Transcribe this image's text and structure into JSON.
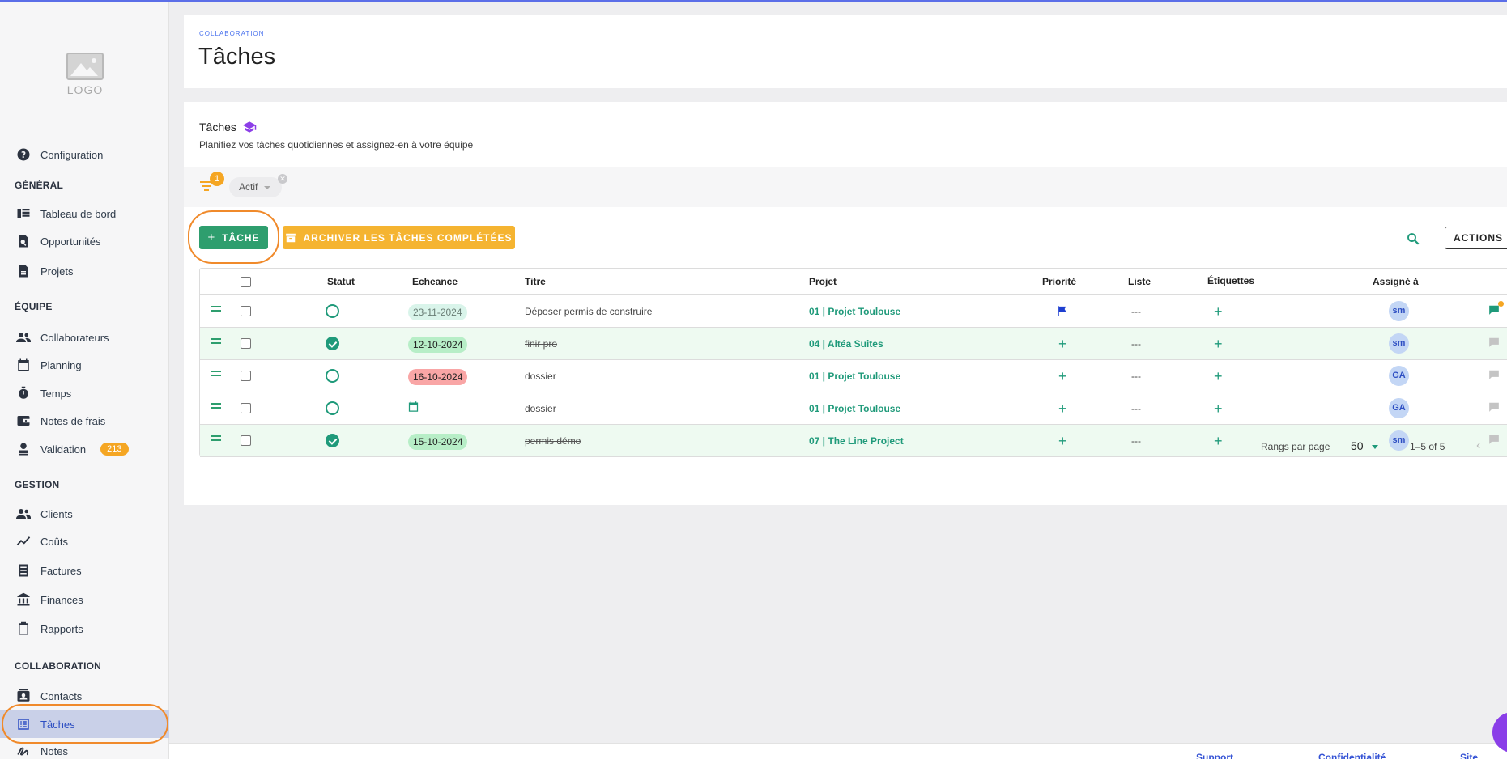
{
  "logo_text": "LOGO",
  "sidebar": {
    "config_label": "Configuration",
    "sections": {
      "general": "GÉNÉRAL",
      "equipe": "ÉQUIPE",
      "gestion": "GESTION",
      "collab": "COLLABORATION"
    },
    "items": {
      "tableau": "Tableau de bord",
      "opportunites": "Opportunités",
      "projets": "Projets",
      "collaborateurs": "Collaborateurs",
      "planning": "Planning",
      "temps": "Temps",
      "notes_frais": "Notes de frais",
      "validation": "Validation",
      "validation_count": "213",
      "clients": "Clients",
      "couts": "Coûts",
      "factures": "Factures",
      "finances": "Finances",
      "rapports": "Rapports",
      "contacts": "Contacts",
      "taches": "Tâches",
      "notes": "Notes"
    }
  },
  "header": {
    "breadcrumb": "COLLABORATION",
    "title": "Tâches"
  },
  "section": {
    "title": "Tâches",
    "subtitle": "Planifiez vos tâches quotidiennes et assignez-en à votre équipe"
  },
  "filters": {
    "count": "1",
    "chip": "Actif"
  },
  "toolbar": {
    "add_task": "TÂCHE",
    "archive": "ARCHIVER LES TÂCHES COMPLÉTÉES",
    "actions": "ACTIONS"
  },
  "table": {
    "headers": {
      "statut": "Statut",
      "echeance": "Echeance",
      "titre": "Titre",
      "projet": "Projet",
      "priorite": "Priorité",
      "liste": "Liste",
      "etiquettes": "Étiquettes",
      "assigne": "Assigné à"
    },
    "rows": [
      {
        "done": false,
        "date": "23-11-2024",
        "date_style": "teal",
        "title": "Déposer permis de construire",
        "project": "01 | Projet Toulouse",
        "priority": "flag",
        "list": "---",
        "assignee": "sm"
      },
      {
        "done": true,
        "date": "12-10-2024",
        "date_style": "green",
        "title": "finir pro",
        "project": "04 | Altéa Suites",
        "priority": "+",
        "list": "---",
        "assignee": "sm"
      },
      {
        "done": false,
        "date": "16-10-2024",
        "date_style": "red",
        "title": "dossier",
        "project": "01 | Projet Toulouse",
        "priority": "+",
        "list": "---",
        "assignee": "GA"
      },
      {
        "done": false,
        "date": "",
        "date_style": "calendar",
        "title": "dossier",
        "project": "01 | Projet Toulouse",
        "priority": "+",
        "list": "---",
        "assignee": "GA"
      },
      {
        "done": true,
        "date": "15-10-2024",
        "date_style": "green",
        "title": "permis démo",
        "project": "07 | The Line Project",
        "priority": "+",
        "list": "---",
        "assignee": "sm"
      }
    ],
    "footer": {
      "rows_per_page_label": "Rangs par page",
      "rows_per_page": "50",
      "range": "1–5 of 5"
    }
  },
  "footer": {
    "support": "Support",
    "privacy": "Confidentialité",
    "site": "Site interne"
  },
  "colors": {
    "primary_green": "#2e9e6e",
    "warning": "#f5b431",
    "accent_blue": "#2d4ec2",
    "highlight": "#f08a2b"
  }
}
